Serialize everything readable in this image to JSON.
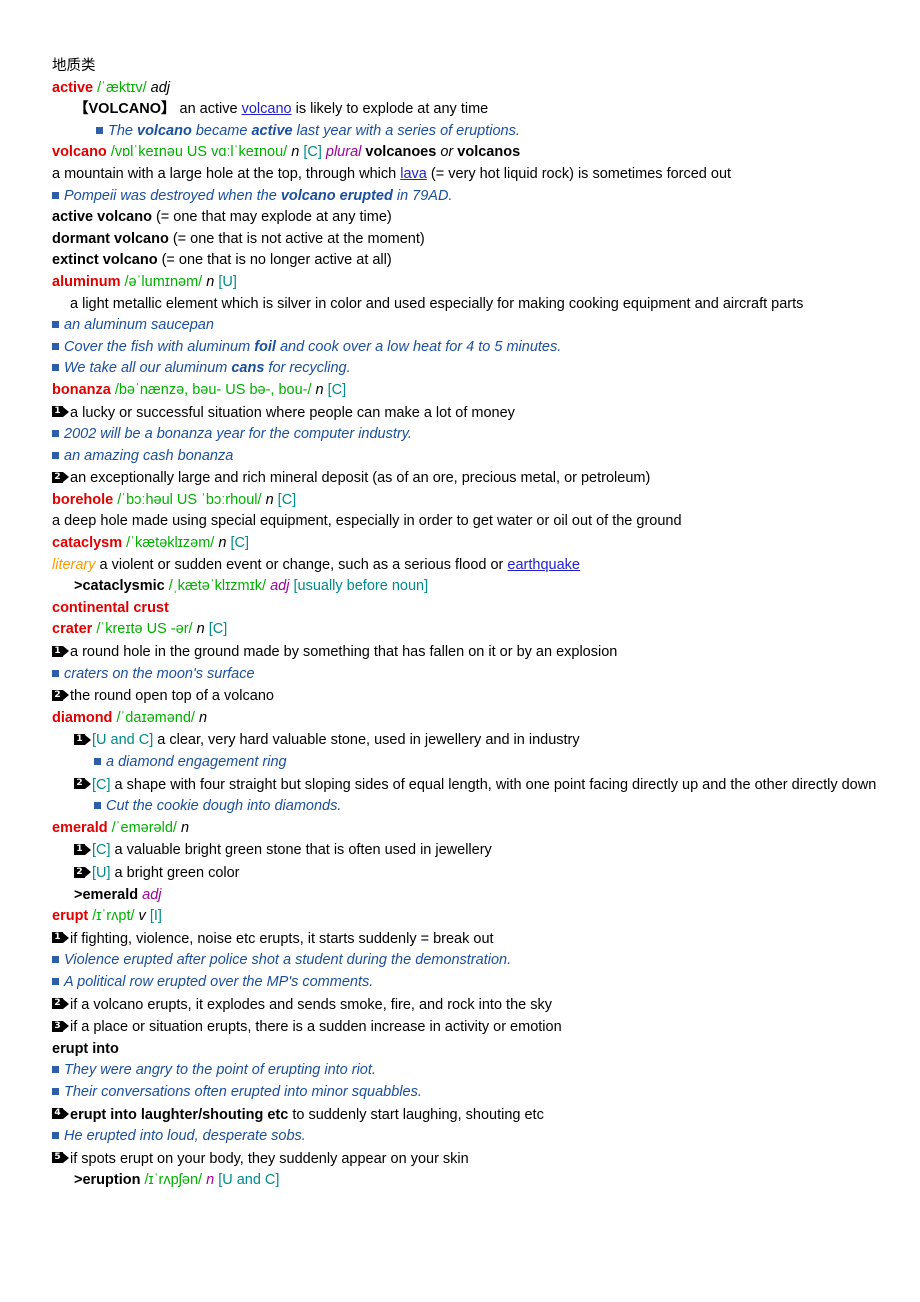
{
  "category": "地质类",
  "colors": {
    "headword": "#e00000",
    "pronunciation": "#00b000",
    "grammar_label": "#008a8a",
    "register_label": "#ff9900",
    "pos_derived": "#a000a0",
    "example": "#1a4f9c",
    "cross_reference": "#2020d0",
    "bullet": "#2d5fa8"
  },
  "entries": [
    {
      "headword": "active",
      "pron": "/ˈæktɪv/",
      "pos": "adj",
      "signpost": "【VOLCANO】",
      "def": " an active ",
      "xref": "volcano",
      "def2": " is likely to explode at any time",
      "examples": [
        {
          "pre": "The ",
          "b1": "volcano",
          "mid": " became ",
          "b2": "active",
          "post": " last year with a series of eruptions."
        }
      ]
    },
    {
      "headword": "volcano",
      "pron": "/vɒlˈkeɪnəu US vɑːlˈkeɪnou/",
      "pos": "n",
      "gram": "[C]",
      "plural_label": "plural",
      "plural_forms_1": "volcanoes",
      "plural_or": "or",
      "plural_forms_2": "volcanos",
      "def_a": "a mountain with a large hole at the top, through which ",
      "xref": "lava",
      "def_b": " (= very hot liquid rock) is sometimes forced out",
      "example": {
        "pre": "Pompeii was destroyed when the ",
        "b1": "volcano erupted",
        "post": " in 79AD."
      },
      "collocations": [
        {
          "term": "active volcano",
          "gloss": " (= one that may explode at any time)"
        },
        {
          "term": "dormant volcano",
          "gloss": " (= one that is not active at the moment)"
        },
        {
          "term": "extinct volcano",
          "gloss": " (= one that is no longer active at all)"
        }
      ]
    },
    {
      "headword": "aluminum",
      "pron": "/əˈlumɪnəm/",
      "pos": "n",
      "gram": "[U]",
      "def": "a light metallic element which is silver in color and used especially for making cooking equipment and aircraft parts",
      "examples": [
        {
          "pre": "an aluminum saucepan",
          "b1": "",
          "post": ""
        },
        {
          "pre": "Cover the fish with aluminum ",
          "b1": "foil",
          "post": " and cook over a low heat for 4 to 5 minutes."
        },
        {
          "pre": "We take all our aluminum ",
          "b1": "cans",
          "post": " for recycling."
        }
      ]
    },
    {
      "headword": "bonanza",
      "pron": "/bəˈnænzə, bəu- US bə-, bou-/",
      "pos": "n",
      "gram": "[C]",
      "senses": [
        {
          "num": "1",
          "def": "a lucky or successful situation where people can make a lot of money",
          "examples": [
            {
              "pre": "2002 will be a bonanza year for the computer industry."
            },
            {
              "pre": "an amazing cash bonanza"
            }
          ]
        },
        {
          "num": "2",
          "def": "an exceptionally large and rich mineral deposit (as of an ore, precious metal, or petroleum)",
          "examples": []
        }
      ]
    },
    {
      "headword": "borehole",
      "pron": "/ˈbɔːhəul US ˈbɔːrhoul/",
      "pos": "n",
      "gram": "[C]",
      "def": "a deep hole made using special equipment, especially in order to get water or oil out of the ground"
    },
    {
      "headword": "cataclysm",
      "pron": "/ˈkætəklɪzəm/",
      "pos": "n",
      "gram": "[C]",
      "register": "literary",
      "def_a": " a violent or sudden event or change, such as a serious flood or ",
      "xref": "earthquake",
      "derived": {
        "marker": ">",
        "word": "cataclysmic",
        "pron": "/ˌkætəˈklɪzmɪk/",
        "pos": "adj",
        "gram": "[usually before noun]"
      }
    },
    {
      "headword": "continental crust"
    },
    {
      "headword": "crater",
      "pron": "/ˈkreɪtə US -ər/",
      "pos": "n",
      "gram": "[C]",
      "senses": [
        {
          "num": "1",
          "def": "a round hole in the ground made by something that has fallen on it or by an explosion",
          "examples": [
            {
              "pre": "craters on the moon's surface"
            }
          ]
        },
        {
          "num": "2",
          "def": "the round open top of a volcano",
          "examples": []
        }
      ]
    },
    {
      "headword": "diamond",
      "pron": "/ˈdaɪəmənd/",
      "pos": "n",
      "senses": [
        {
          "num": "1",
          "gram": "[U and C]",
          "def": " a clear, very hard valuable stone, used in jewellery and in industry",
          "examples": [
            {
              "pre": "a diamond engagement ring"
            }
          ]
        },
        {
          "num": "2",
          "gram": "[C]",
          "def": " a shape with four straight but sloping sides of equal length, with one point facing directly up and the other directly down",
          "examples": [
            {
              "pre": "Cut the cookie dough into diamonds."
            }
          ]
        }
      ]
    },
    {
      "headword": "emerald",
      "pron": "/ˈemərəld/",
      "pos": "n",
      "senses": [
        {
          "num": "1",
          "gram": "[C]",
          "def": " a valuable bright green stone that is often used in jewellery",
          "examples": []
        },
        {
          "num": "2",
          "gram": "[U]",
          "def": " a bright green color",
          "examples": []
        }
      ],
      "derived": {
        "marker": ">",
        "word": "emerald",
        "pos": "adj"
      }
    },
    {
      "headword": "erupt",
      "pron": "/ɪˈrʌpt/",
      "pos": "v",
      "gram": "[I]",
      "senses": [
        {
          "num": "1",
          "def": "if fighting, violence, noise etc erupts, it starts suddenly = break out",
          "examples": [
            {
              "pre": "Violence erupted after police shot a student during the demonstration."
            },
            {
              "pre": "A political row erupted over the MP's comments."
            }
          ]
        },
        {
          "num": "2",
          "def": "if a volcano erupts, it explodes and sends smoke, fire, and rock into the sky",
          "examples": []
        },
        {
          "num": "3",
          "def": "if a place or situation erupts, there is a sudden increase in activity or emotion",
          "phrase_heading": "erupt into",
          "examples": [
            {
              "pre": "They were angry to the point of erupting into riot."
            },
            {
              "pre": "Their conversations often erupted into minor squabbles."
            }
          ]
        },
        {
          "num": "4",
          "bold_lead": "erupt into laughter/shouting etc",
          "def": " to suddenly start laughing, shouting etc",
          "examples": [
            {
              "pre": "He erupted into loud, desperate sobs."
            }
          ]
        },
        {
          "num": "5",
          "def": "if spots erupt on your body, they suddenly appear on your skin",
          "examples": []
        }
      ],
      "derived": {
        "marker": ">",
        "word": "eruption",
        "pron": "/ɪˈrʌpʃən/",
        "pos": "n",
        "gram": "[U and C]"
      }
    }
  ]
}
